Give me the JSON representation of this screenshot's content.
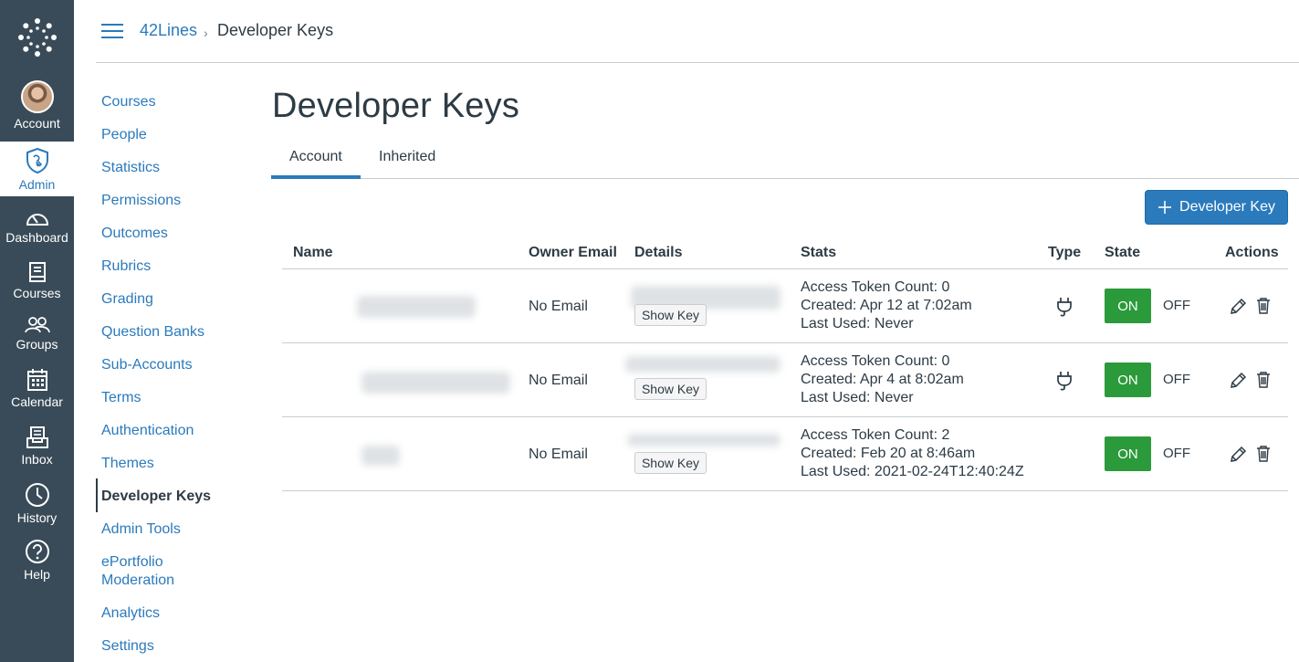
{
  "global_nav": {
    "items": [
      {
        "label": "Account",
        "icon": "avatar"
      },
      {
        "label": "Admin",
        "icon": "admin-shield-icon"
      },
      {
        "label": "Dashboard",
        "icon": "dashboard-icon"
      },
      {
        "label": "Courses",
        "icon": "courses-icon"
      },
      {
        "label": "Groups",
        "icon": "groups-icon"
      },
      {
        "label": "Calendar",
        "icon": "calendar-icon"
      },
      {
        "label": "Inbox",
        "icon": "inbox-icon"
      },
      {
        "label": "History",
        "icon": "history-icon"
      },
      {
        "label": "Help",
        "icon": "help-icon"
      }
    ]
  },
  "header": {
    "breadcrumb_root": "42Lines",
    "breadcrumb_sep": "›",
    "breadcrumb_current": "Developer Keys"
  },
  "left_nav": {
    "items": [
      "Courses",
      "People",
      "Statistics",
      "Permissions",
      "Outcomes",
      "Rubrics",
      "Grading",
      "Question Banks",
      "Sub-Accounts",
      "Terms",
      "Authentication",
      "Themes",
      "Developer Keys",
      "Admin Tools",
      "ePortfolio",
      "Moderation",
      "Analytics",
      "Settings"
    ],
    "active": "Developer Keys"
  },
  "main": {
    "title": "Developer Keys",
    "tabs": [
      "Account",
      "Inherited"
    ],
    "active_tab": "Account",
    "add_button_label": "Developer Key",
    "columns": [
      "Name",
      "Owner Email",
      "Details",
      "Stats",
      "Type",
      "State",
      "Actions"
    ],
    "rows": [
      {
        "owner_email": "No Email",
        "show_key_label": "Show Key",
        "stats": [
          "Access Token Count: 0",
          "Created: Apr 12 at 7:02am",
          "Last Used: Never"
        ],
        "type_icon": "plug-icon",
        "state_on": "ON",
        "state_off": "OFF"
      },
      {
        "owner_email": "No Email",
        "show_key_label": "Show Key",
        "stats": [
          "Access Token Count: 0",
          "Created: Apr 4 at 8:02am",
          "Last Used: Never"
        ],
        "type_icon": "plug-icon",
        "state_on": "ON",
        "state_off": "OFF"
      },
      {
        "owner_email": "No Email",
        "show_key_label": "Show Key",
        "stats": [
          "Access Token Count: 2",
          "Created: Feb 20 at 8:46am",
          "Last Used: 2021-02-24T12:40:24Z"
        ],
        "type_icon": "",
        "state_on": "ON",
        "state_off": "OFF"
      }
    ]
  },
  "colors": {
    "nav_bg": "#394b58",
    "link": "#2b7abc",
    "on_green": "#2b9a3a",
    "text": "#2d3b45"
  }
}
